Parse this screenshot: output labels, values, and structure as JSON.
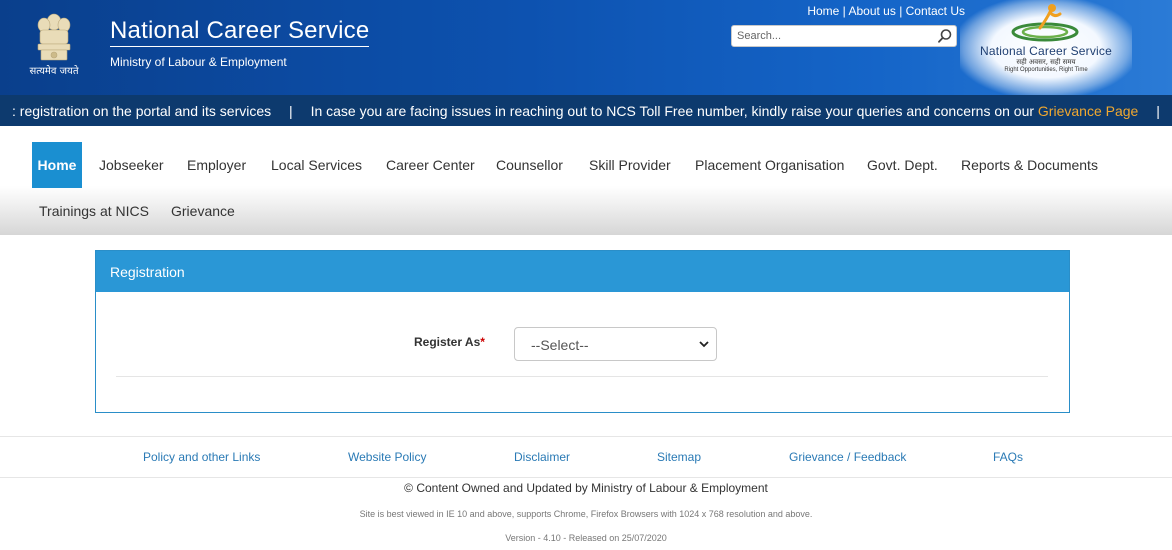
{
  "header": {
    "emblem_text": "सत्यमेव जयते",
    "title": "National Career Service",
    "subtitle": "Ministry of Labour & Employment",
    "top_links": [
      "Home",
      "About us",
      "Contact Us"
    ],
    "search_placeholder": "Search...",
    "logo": {
      "name": "National Career Service",
      "hindi": "सही अवसर, सही समय",
      "tagline": "Right Opportunities, Right Time"
    }
  },
  "ticker": {
    "text1": ": registration on the portal and its services",
    "separator": "|",
    "text2": "In case you are facing issues in reaching out to NCS Toll Free number, kindly raise your queries and concerns on our",
    "link": "Grievance Page"
  },
  "nav": {
    "items": [
      "Home",
      "Jobseeker",
      "Employer",
      "Local Services",
      "Career Center",
      "Counsellor",
      "Skill Provider",
      "Placement Organisation",
      "Govt. Dept.",
      "Reports & Documents",
      "Trainings at NICS",
      "Grievance"
    ]
  },
  "registration": {
    "heading": "Registration",
    "label": "Register As",
    "required_mark": "*",
    "select_value": "--Select--"
  },
  "footer": {
    "links": [
      "Policy and other Links",
      "Website Policy",
      "Disclaimer",
      "Sitemap",
      "Grievance / Feedback",
      "FAQs"
    ],
    "copyright": "© Content Owned and Updated by Ministry of Labour & Employment",
    "browser_note": "Site is best viewed in IE 10 and above, supports Chrome, Firefox Browsers with 1024 x 768 resolution and above.",
    "version": "Version - 4.10 - Released on 25/07/2020"
  },
  "colors": {
    "header_blue": "#0d52b0",
    "ticker_bg": "#0d3a6e",
    "accent_blue": "#1a8fd1",
    "link_orange": "#f0a830",
    "footer_link": "#2a7ab5"
  }
}
